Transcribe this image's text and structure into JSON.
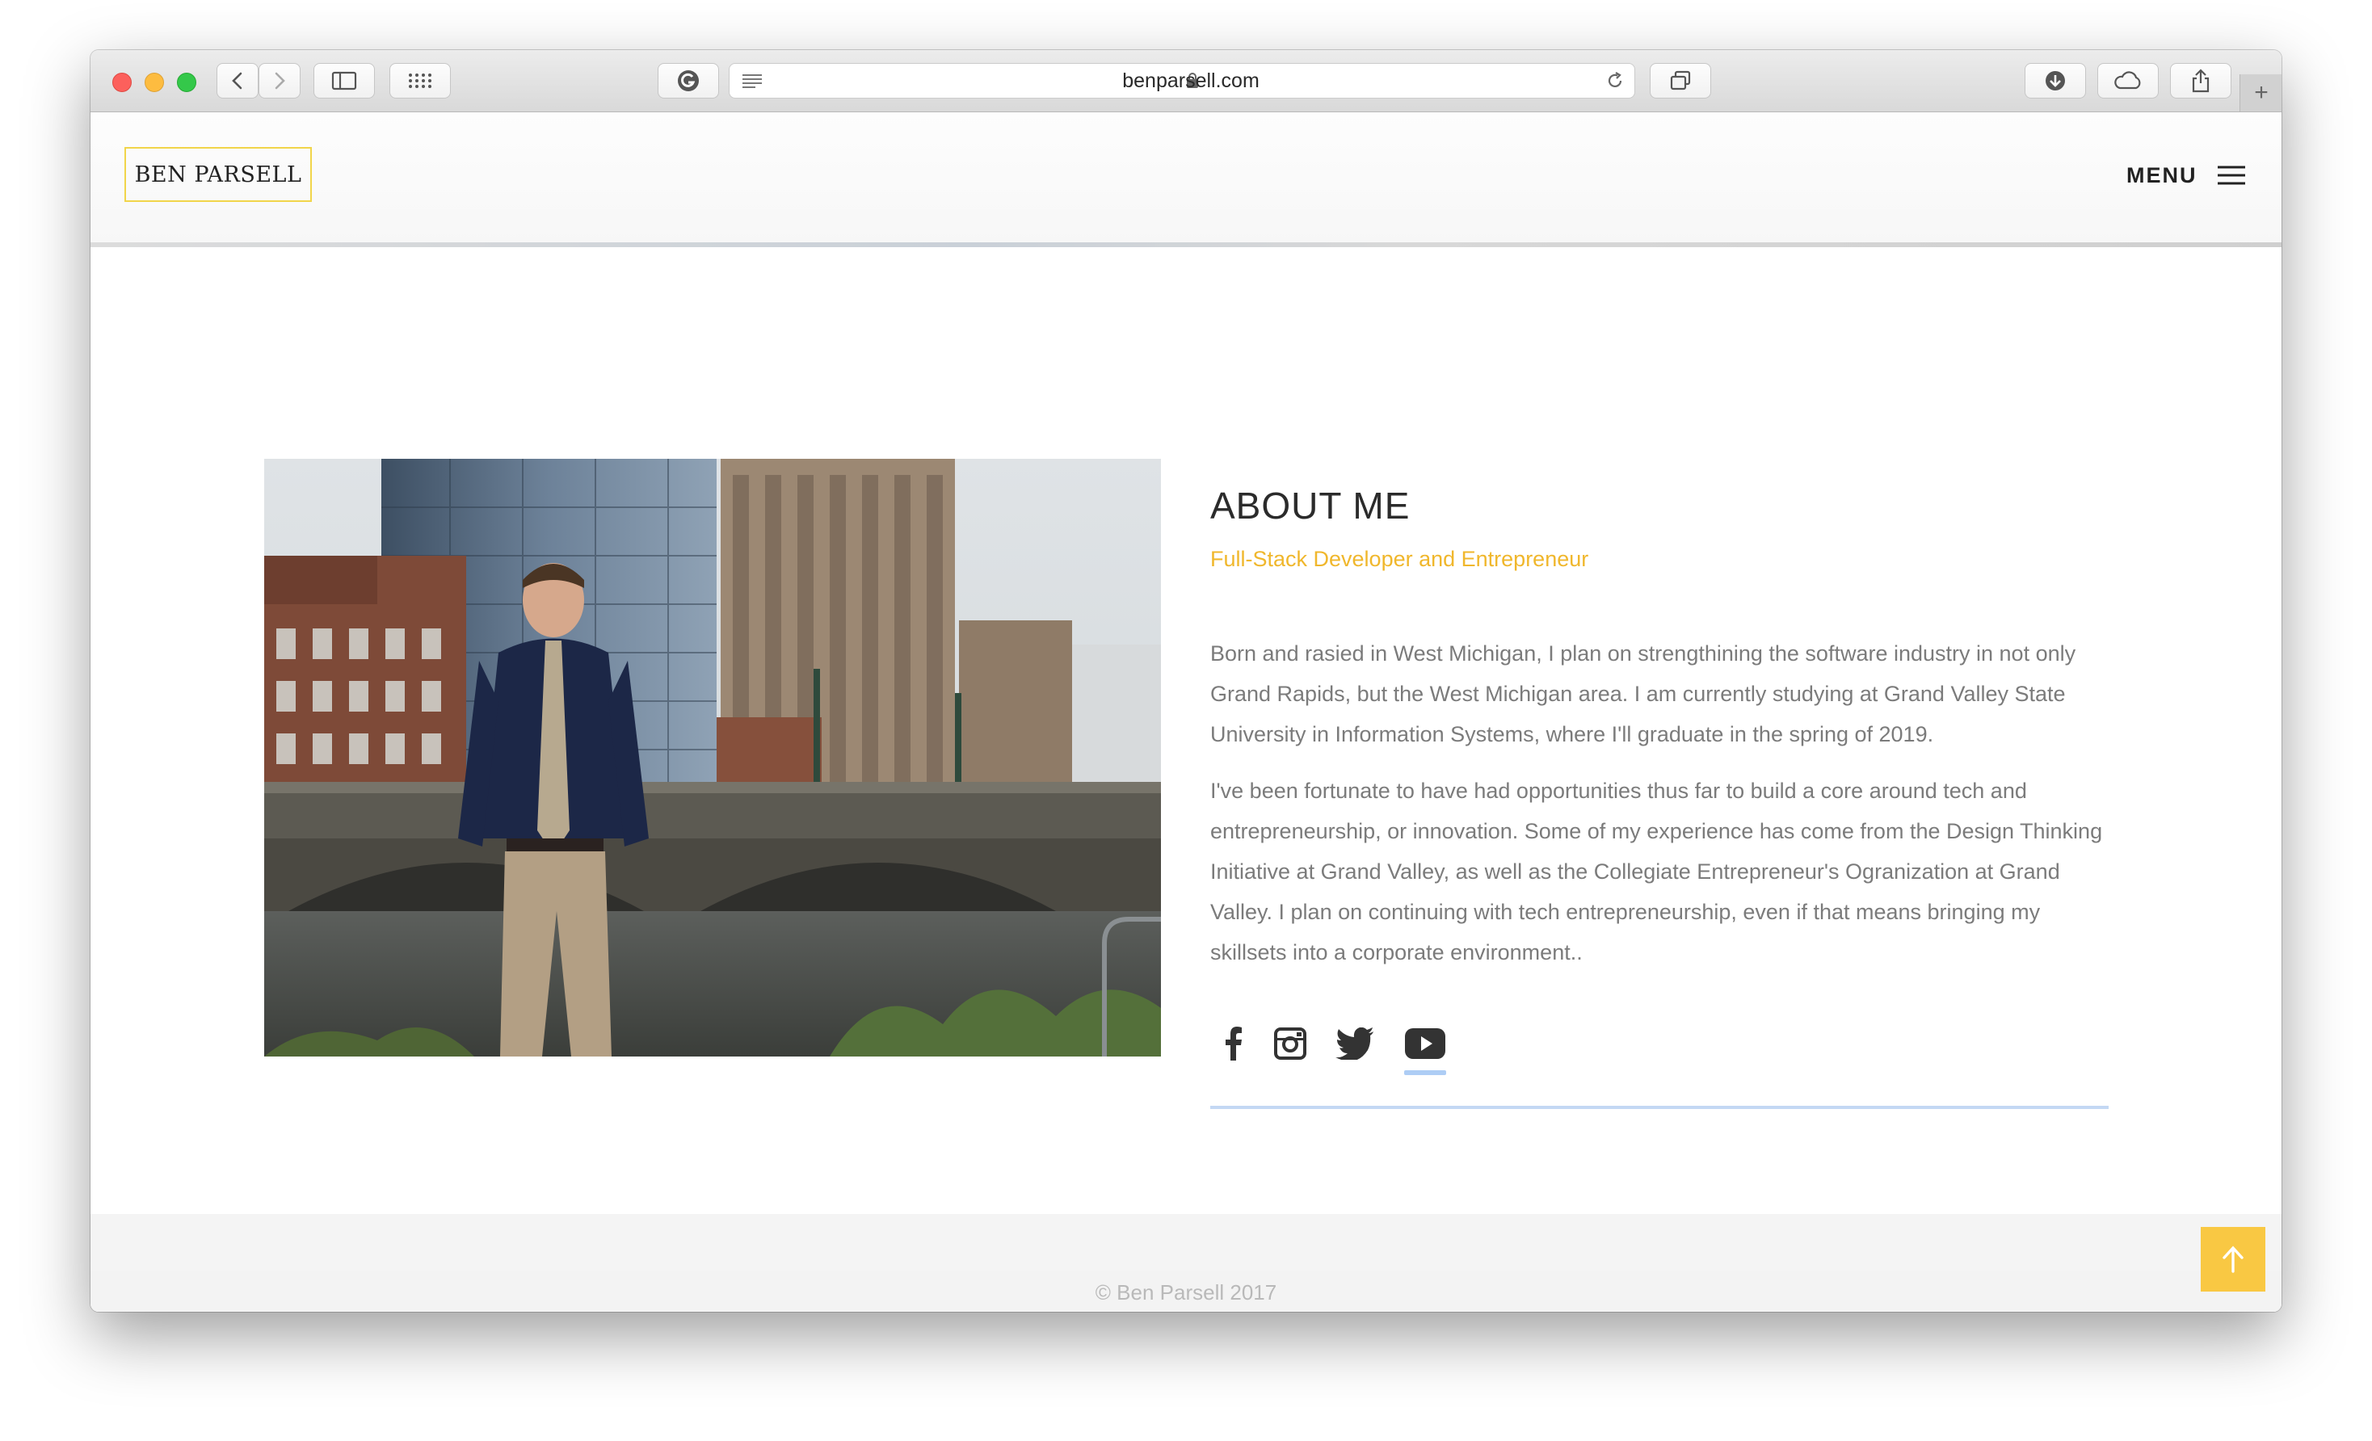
{
  "browser": {
    "url": "benparsell.com"
  },
  "site": {
    "logo": "BEN PARSELL",
    "menu_label": "MENU"
  },
  "about": {
    "title": "ABOUT ME",
    "subtitle": "Full-Stack Developer and Entrepreneur",
    "paragraphs": [
      "Born and rasied in West Michigan, I plan on strengthining the software industry in not only Grand Rapids, but the West Michigan area. I am currently studying at Grand Valley State University in Information Systems, where I'll graduate in the spring of 2019.",
      "I've been fortunate to have had opportunities thus far to build a core around tech and entrepreneurship, or innovation. Some of my experience has come from the Design Thinking Initiative at Grand Valley, as well as the Collegiate Entrepreneur's Ogranization at Grand Valley. I plan on continuing with tech entrepreneurship, even if that means bringing my skillsets into a corporate environment.."
    ],
    "socials": [
      "facebook-icon",
      "instagram-icon",
      "twitter-icon",
      "youtube-icon"
    ]
  },
  "footer": {
    "copyright": "© Ben Parsell 2017"
  },
  "colors": {
    "accent": "#f0b72c",
    "logo_border": "#f1d54a",
    "scroll_top": "#f9c843",
    "social_underline": "#aecdf5"
  }
}
